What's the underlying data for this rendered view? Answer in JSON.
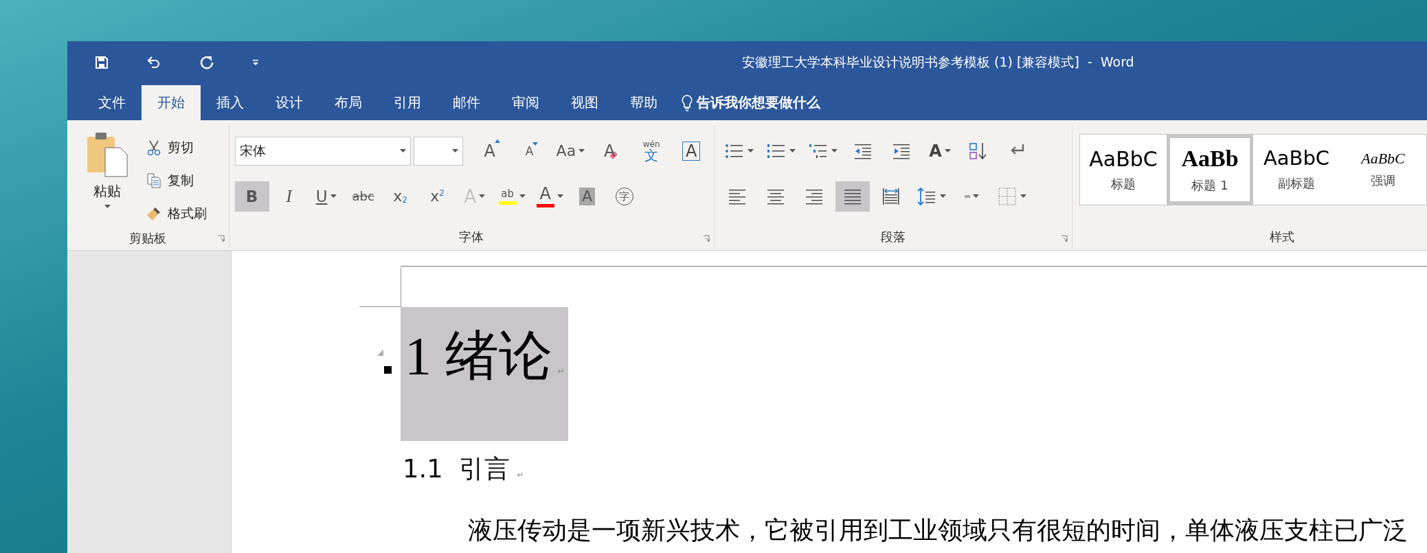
{
  "window": {
    "title": "安徽理工大学本科毕业设计说明书参考模板 (1) [兼容模式]  -  Word"
  },
  "quick_access": [
    {
      "kind": "save"
    },
    {
      "kind": "undo"
    },
    {
      "kind": "redo"
    },
    {
      "kind": "customize"
    }
  ],
  "tabs": [
    {
      "label": "文件",
      "selected": false
    },
    {
      "label": "开始",
      "selected": true
    },
    {
      "label": "插入",
      "selected": false
    },
    {
      "label": "设计",
      "selected": false
    },
    {
      "label": "布局",
      "selected": false
    },
    {
      "label": "引用",
      "selected": false
    },
    {
      "label": "邮件",
      "selected": false
    },
    {
      "label": "审阅",
      "selected": false
    },
    {
      "label": "视图",
      "selected": false
    },
    {
      "label": "帮助",
      "selected": false
    }
  ],
  "tell_me": {
    "label": "告诉我你想要做什么"
  },
  "ribbon": {
    "clipboard": {
      "label": "剪贴板",
      "paste": "粘贴",
      "items": [
        {
          "kind": "cut",
          "label": "剪切"
        },
        {
          "kind": "copy",
          "label": "复制"
        },
        {
          "kind": "format-painter",
          "label": "格式刷"
        }
      ]
    },
    "font": {
      "label": "字体",
      "font_name": "宋体",
      "row1": [
        {
          "kind": "grow",
          "glyph": "A",
          "dropdown": false
        },
        {
          "kind": "shrink",
          "glyph": "A",
          "dropdown": false
        },
        {
          "kind": "case",
          "glyph": "Aa",
          "dropdown": true
        },
        {
          "kind": "clear",
          "glyph": "A",
          "dropdown": false
        },
        {
          "kind": "phonetic",
          "glyph": "文",
          "ruby": "wén",
          "dropdown": false
        },
        {
          "kind": "border",
          "glyph": "A",
          "dropdown": false
        }
      ],
      "row2": [
        {
          "kind": "bold",
          "glyph": "B",
          "dropdown": false,
          "selected": true,
          "disabled": false
        },
        {
          "kind": "italic",
          "glyph": "I",
          "dropdown": false,
          "selected": false,
          "disabled": false
        },
        {
          "kind": "underline",
          "glyph": "U",
          "dropdown": true,
          "selected": false,
          "disabled": false
        },
        {
          "kind": "strike",
          "glyph": "abc",
          "dropdown": false,
          "selected": false,
          "disabled": false
        },
        {
          "kind": "subscript",
          "glyph": "x",
          "index": "2",
          "dropdown": false,
          "selected": false,
          "disabled": false
        },
        {
          "kind": "superscript",
          "glyph": "x",
          "index": "2",
          "dropdown": false,
          "selected": false,
          "disabled": false
        },
        {
          "kind": "effects",
          "glyph": "A",
          "dropdown": true,
          "selected": false,
          "disabled": true
        },
        {
          "kind": "highlight",
          "glyph": "ab",
          "dropdown": true,
          "selected": false,
          "disabled": false,
          "color": "#ffff00"
        },
        {
          "kind": "font-color",
          "glyph": "A",
          "dropdown": true,
          "selected": false,
          "disabled": false,
          "color": "#ff0000"
        },
        {
          "kind": "shading",
          "glyph": "A",
          "dropdown": false,
          "selected": false,
          "disabled": false
        },
        {
          "kind": "enclose",
          "glyph": "字",
          "dropdown": false,
          "selected": false,
          "disabled": false
        }
      ]
    },
    "paragraph": {
      "label": "段落",
      "row1": [
        {
          "kind": "bullets",
          "dropdown": true
        },
        {
          "kind": "numbering",
          "dropdown": true
        },
        {
          "kind": "multilevel",
          "dropdown": true
        },
        {
          "kind": "outdent",
          "dropdown": false
        },
        {
          "kind": "indent",
          "dropdown": false
        },
        {
          "kind": "text-direction",
          "glyph": "A",
          "dropdown": true
        },
        {
          "kind": "sort",
          "dropdown": false
        },
        {
          "kind": "show-marks",
          "dropdown": false
        }
      ],
      "row2": [
        {
          "kind": "align-left",
          "dropdown": false,
          "selected": false
        },
        {
          "kind": "align-center",
          "dropdown": false,
          "selected": false
        },
        {
          "kind": "align-right",
          "dropdown": false,
          "selected": false
        },
        {
          "kind": "justify",
          "dropdown": false,
          "selected": true
        },
        {
          "kind": "distribute",
          "dropdown": false,
          "selected": false
        },
        {
          "kind": "line-spacing",
          "dropdown": true,
          "selected": false
        },
        {
          "kind": "shading",
          "dropdown": true,
          "selected": false
        },
        {
          "kind": "borders",
          "dropdown": true,
          "selected": false
        }
      ]
    },
    "styles": {
      "label": "样式",
      "items": [
        {
          "kind": "title",
          "preview": "AaBbC",
          "label": "标题",
          "selected": false
        },
        {
          "kind": "heading",
          "preview": "AaBb",
          "label": "标题 1",
          "selected": true
        },
        {
          "kind": "subtitle",
          "preview": "AaBbC",
          "label": "副标题",
          "selected": false
        },
        {
          "kind": "emphasis",
          "preview": "AaBbC",
          "label": "强调",
          "selected": false
        }
      ]
    }
  },
  "document": {
    "heading": {
      "text": "1 绪论",
      "highlighted": true,
      "mark": "↵"
    },
    "subheading": {
      "text": "1.1  引言",
      "mark": "↵"
    },
    "body": {
      "text": "液压传动是一项新兴技术，它被引用到工业领域只有很短的时间，单体液压支柱已广泛"
    }
  }
}
